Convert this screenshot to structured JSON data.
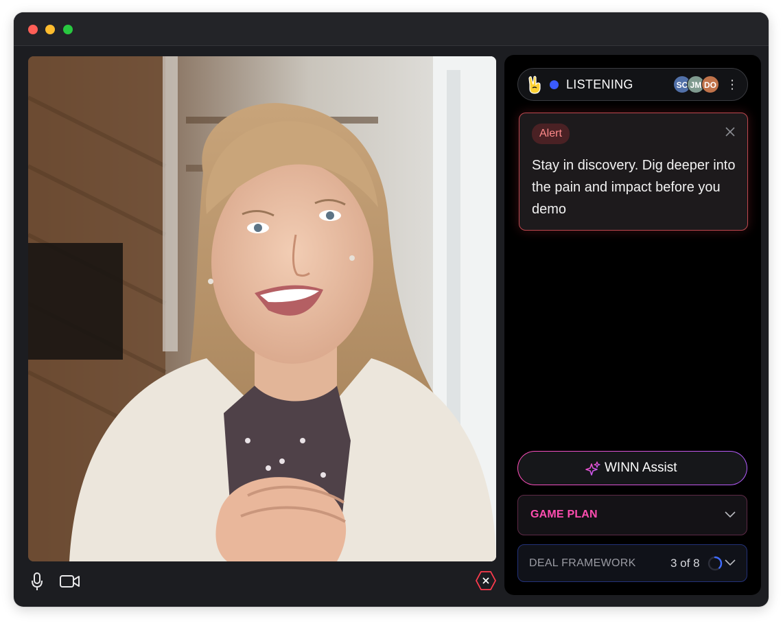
{
  "window": {
    "traffic_lights": [
      "close",
      "minimize",
      "zoom"
    ]
  },
  "video": {
    "subject": "participant-video-feed"
  },
  "controls": {
    "mic_icon": "microphone-icon",
    "camera_icon": "video-camera-icon",
    "end_icon": "end-call-hexagon-icon"
  },
  "status": {
    "label": "LISTENING",
    "indicator_color": "#3a5bff",
    "participants": [
      {
        "initials": "SC",
        "color": "#5170a8"
      },
      {
        "initials": "JM",
        "color": "#7f9a8f"
      },
      {
        "initials": "DO",
        "color": "#c0734a"
      }
    ],
    "menu_icon": "more-vertical-icon"
  },
  "alert": {
    "badge": "Alert",
    "message": "Stay in discovery. Dig deeper into the pain and impact before you demo",
    "accent": "#c0484f"
  },
  "assist": {
    "label": "WINN Assist",
    "gradient": [
      "#ff4db8",
      "#b25cff"
    ]
  },
  "game_plan": {
    "label": "GAME PLAN",
    "color": "#ff4db0"
  },
  "deal_framework": {
    "label": "DEAL FRAMEWORK",
    "progress_text": "3 of 8",
    "completed": 3,
    "total": 8
  }
}
